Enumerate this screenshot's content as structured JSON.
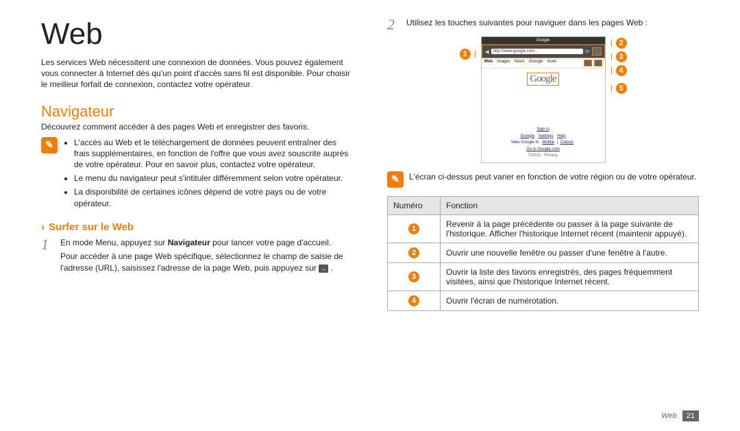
{
  "left": {
    "title": "Web",
    "intro": "Les services Web nécessitent une connexion de données. Vous pouvez également vous connecter à Internet dès qu'un point d'accès sans fil est disponible. Pour choisir le meilleur forfait de connexion, contactez votre opérateur.",
    "section": "Navigateur",
    "section_sub": "Découvrez comment accéder à des pages Web et enregistrer des favoris.",
    "note_items": [
      "L'accès au Web et le téléchargement de données peuvent entraîner des frais supplémentaires, en fonction de l'offre que vous avez souscrite auprès de votre opérateur. Pour en savoir plus, contactez votre opérateur.",
      "Le menu du navigateur peut s'intituler différemment selon votre opérateur.",
      "La disponibilité de certaines icônes dépend de votre pays ou de votre opérateur."
    ],
    "sub_section": "Surfer sur le Web",
    "step1_a": "En mode Menu, appuyez sur ",
    "step1_bold": "Navigateur",
    "step1_b": " pour lancer votre page d'accueil.",
    "step1_para2_a": "Pour accéder à une page Web spécifique, sélectionnez le champ de saisie de l'adresse (URL), saisissez l'adresse de la page Web, puis appuyez sur ",
    "step1_para2_b": "."
  },
  "right": {
    "step2": "Utilisez les touches suivantes pour naviguer dans les pages Web :",
    "note2": "L'écran ci-dessus peut varier en fonction de votre région ou de votre opérateur.",
    "table": {
      "h1": "Numéro",
      "h2": "Fonction",
      "rows": [
        {
          "n": "1",
          "f": "Revenir à la page précédente ou passer à la page suivante de l'historique. Afficher l'historique Internet récent (maintenir appuyé)."
        },
        {
          "n": "2",
          "f": "Ouvrir une nouvelle fenêtre ou passer d'une fenêtre à l'autre."
        },
        {
          "n": "3",
          "f": "Ouvrir la liste des favoris enregistrés, des pages fréquemment visitées, ainsi que l'historique Internet récent."
        },
        {
          "n": "4",
          "f": "Ouvrir l'écran de numérotation."
        }
      ]
    },
    "mock": {
      "top_title": "Google",
      "url": "http://www.google.com...",
      "tabs": [
        "Web",
        "Images",
        "News",
        "iGoogle",
        "more"
      ],
      "logo": "Google",
      "links_line1": "Sign in",
      "links_line2": [
        "iGoogle",
        "Settings",
        "Help"
      ],
      "links_line3_a": "View Google in: ",
      "links_line3_b": "Mobile",
      "links_line3_c": " | ",
      "links_line3_d": "Classic",
      "links_line4": "Go to Google.com",
      "links_line5": "©2010 - Privacy"
    },
    "callouts": {
      "c1": "1",
      "c2": "2",
      "c3": "3",
      "c4": "4",
      "c5": "5"
    }
  },
  "footer": {
    "section": "Web",
    "page": "21"
  }
}
